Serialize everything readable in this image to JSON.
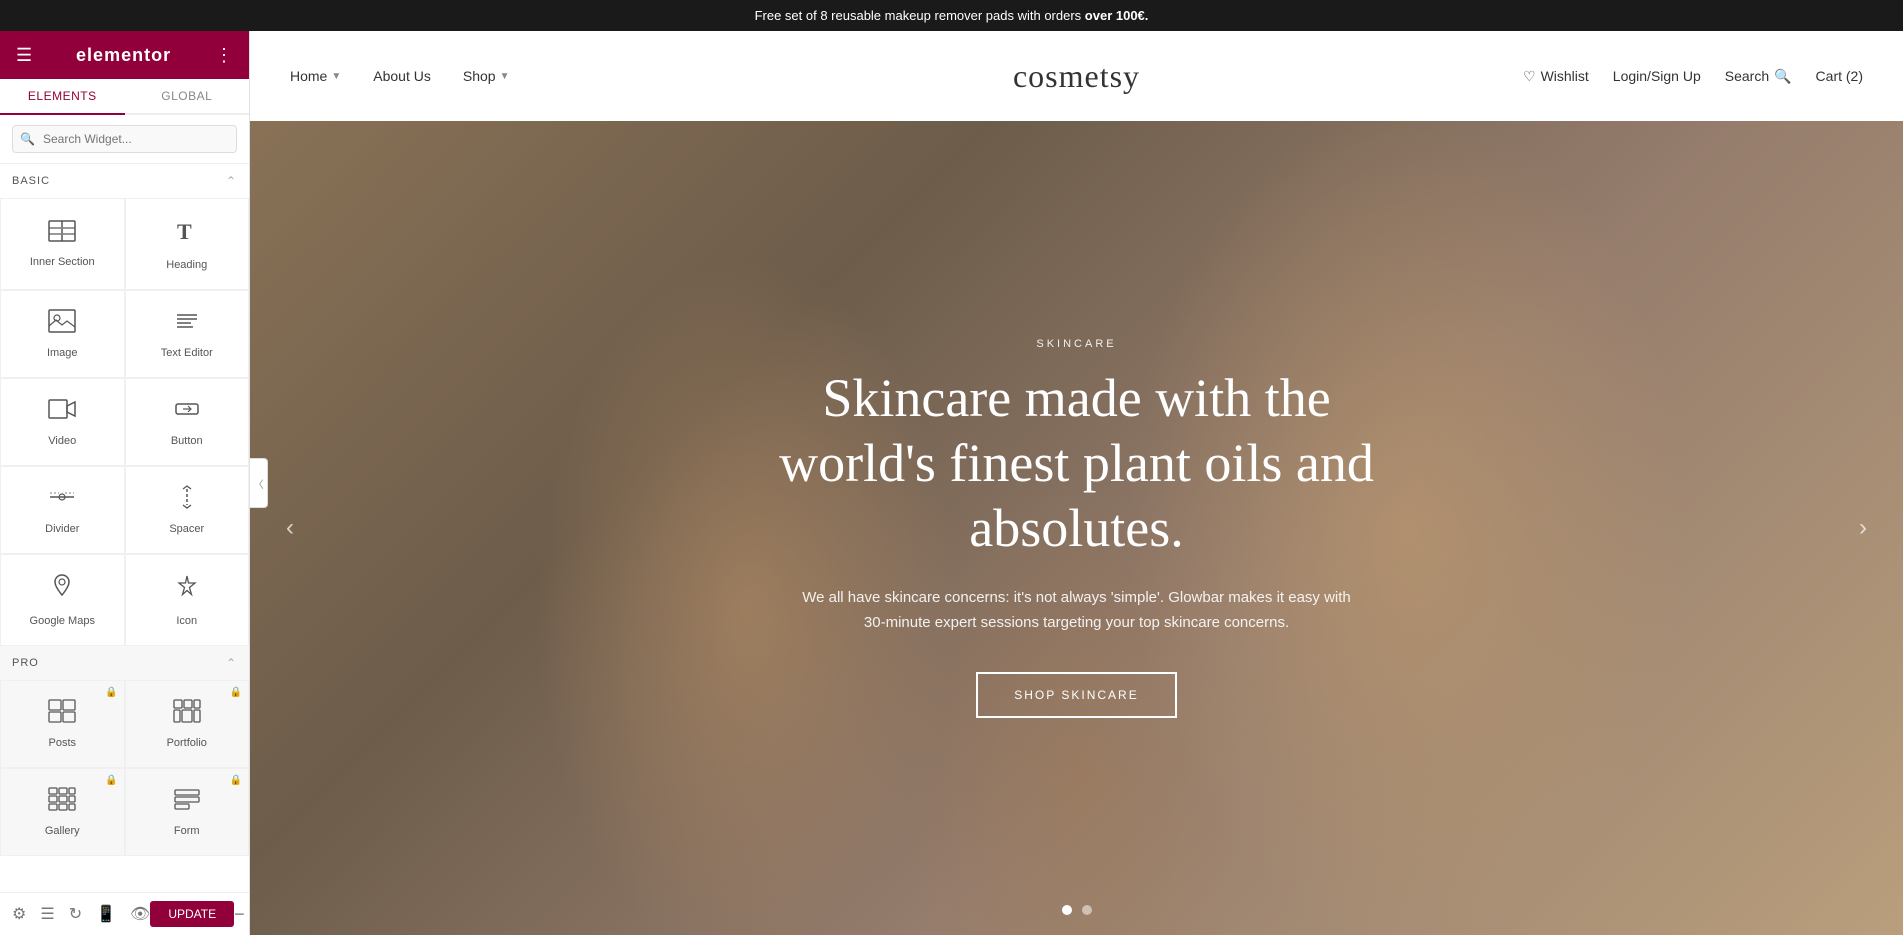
{
  "announcement": {
    "text_before": "Free set of 8 reusable makeup remover pads with orders ",
    "text_bold": "over 100€.",
    "full_text": "Free set of 8 reusable makeup remover pads with orders over 100€."
  },
  "sidebar": {
    "logo": "elementor",
    "tabs": [
      {
        "id": "elements",
        "label": "ELEMENTS"
      },
      {
        "id": "global",
        "label": "GLOBAL"
      }
    ],
    "search_placeholder": "Search Widget...",
    "basic_section": "BASIC",
    "widgets_basic": [
      {
        "id": "inner-section",
        "label": "Inner Section",
        "icon": "inner-section-icon",
        "locked": false
      },
      {
        "id": "heading",
        "label": "Heading",
        "icon": "heading-icon",
        "locked": false
      },
      {
        "id": "image",
        "label": "Image",
        "icon": "image-icon",
        "locked": false
      },
      {
        "id": "text-editor",
        "label": "Text Editor",
        "icon": "text-editor-icon",
        "locked": false
      },
      {
        "id": "video",
        "label": "Video",
        "icon": "video-icon",
        "locked": false
      },
      {
        "id": "button",
        "label": "Button",
        "icon": "button-icon",
        "locked": false
      },
      {
        "id": "divider",
        "label": "Divider",
        "icon": "divider-icon",
        "locked": false
      },
      {
        "id": "spacer",
        "label": "Spacer",
        "icon": "spacer-icon",
        "locked": false
      },
      {
        "id": "google-maps",
        "label": "Google Maps",
        "icon": "google-maps-icon",
        "locked": false
      },
      {
        "id": "icon",
        "label": "Icon",
        "icon": "icon-icon",
        "locked": false
      }
    ],
    "pro_section": "PRO",
    "widgets_pro": [
      {
        "id": "posts",
        "label": "Posts",
        "icon": "posts-icon",
        "locked": true
      },
      {
        "id": "portfolio",
        "label": "Portfolio",
        "icon": "portfolio-icon",
        "locked": true
      },
      {
        "id": "gallery",
        "label": "Gallery",
        "icon": "gallery-icon",
        "locked": true
      },
      {
        "id": "form",
        "label": "Form",
        "icon": "form-icon",
        "locked": true
      }
    ],
    "footer": {
      "icons": [
        "settings-icon",
        "layers-icon",
        "history-icon",
        "mobile-icon",
        "eye-icon"
      ],
      "update_button": "UPDATE",
      "minus_icon": "minus-icon"
    }
  },
  "site": {
    "nav_left": [
      {
        "id": "home",
        "label": "Home",
        "has_dropdown": true
      },
      {
        "id": "about",
        "label": "About Us",
        "has_dropdown": false
      },
      {
        "id": "shop",
        "label": "Shop",
        "has_dropdown": true
      }
    ],
    "logo": "cosmetsy",
    "nav_right": [
      {
        "id": "wishlist",
        "label": "Wishlist",
        "icon": "wishlist-icon"
      },
      {
        "id": "login",
        "label": "Login/Sign Up",
        "icon": "login-icon"
      },
      {
        "id": "search",
        "label": "Search",
        "icon": "search-icon"
      },
      {
        "id": "cart",
        "label": "Cart (2)",
        "icon": "cart-icon"
      }
    ]
  },
  "hero": {
    "category": "SKINCARE",
    "title": "Skincare made with the world's finest plant oils and absolutes.",
    "description": "We all have skincare concerns: it's not always 'simple'. Glowbar makes it easy with 30-minute expert sessions targeting your top skincare concerns.",
    "cta_label": "SHOP SKINCARE",
    "slide_count": 2,
    "active_slide": 0
  }
}
